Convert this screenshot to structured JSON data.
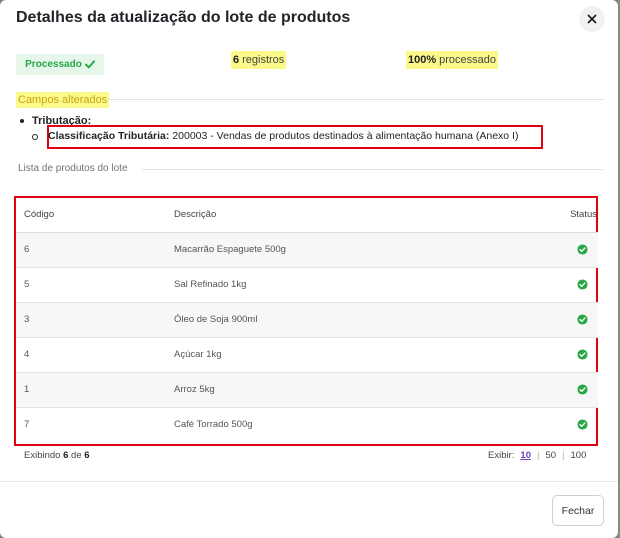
{
  "modal": {
    "title": "Detalhes da atualização do lote de produtos",
    "close_icon": "close-icon"
  },
  "summary": {
    "status_badge": "Processado",
    "status_icon": "check-icon",
    "records_count": "6",
    "records_label": "registros",
    "percent_value": "100%",
    "percent_label": "processado"
  },
  "changes": {
    "section_title": "Campos alterados",
    "group_label": "Tributação:",
    "field_label": "Classificação Tributária:",
    "field_value": "200003 - Vendas de produtos destinados à alimentação humana (Anexo I)"
  },
  "products": {
    "section_title": "Lista de produtos do lote",
    "columns": [
      "Código",
      "Descrição",
      "Status"
    ],
    "rows": [
      {
        "code": "6",
        "description": "Macarrão Espaguete 500g",
        "status": "check-circle-icon"
      },
      {
        "code": "5",
        "description": "Sal Refinado 1kg",
        "status": "check-circle-icon"
      },
      {
        "code": "3",
        "description": "Óleo de Soja 900ml",
        "status": "check-circle-icon"
      },
      {
        "code": "4",
        "description": "Açúcar 1kg",
        "status": "check-circle-icon"
      },
      {
        "code": "1",
        "description": "Arroz 5kg",
        "status": "check-circle-icon"
      },
      {
        "code": "7",
        "description": "Café Torrado 500g",
        "status": "check-circle-icon"
      }
    ]
  },
  "pagination": {
    "showing_prefix": "Exibindo",
    "shown": "6",
    "of_label": "de",
    "total": "6",
    "per_page_label": "Exibir:",
    "options": [
      "10",
      "50",
      "100"
    ],
    "selected": "10"
  },
  "footer": {
    "close_label": "Fechar"
  },
  "colors": {
    "success": "#28a745",
    "highlight": "#fbf98a",
    "annotation_red": "#e0000f",
    "link_active": "#6f42c1"
  }
}
